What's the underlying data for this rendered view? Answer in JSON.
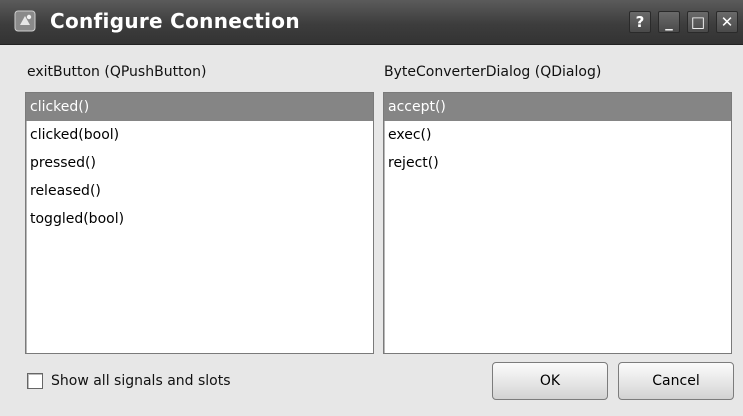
{
  "window": {
    "title": "Configure Connection",
    "controls": {
      "help": "?",
      "minimize": "_",
      "maximize": "□",
      "close": "✕"
    }
  },
  "sender": {
    "heading": "exitButton (QPushButton)",
    "items": [
      "clicked()",
      "clicked(bool)",
      "pressed()",
      "released()",
      "toggled(bool)"
    ],
    "selected_index": 0
  },
  "receiver": {
    "heading": "ByteConverterDialog (QDialog)",
    "items": [
      "accept()",
      "exec()",
      "reject()"
    ],
    "selected_index": 0
  },
  "options": {
    "show_all_label": "Show all signals and slots",
    "show_all_checked": false
  },
  "buttons": {
    "ok_label": "OK",
    "cancel_label": "Cancel"
  },
  "colors": {
    "selection": "#858585",
    "titlebar": "#3d3d3d"
  }
}
